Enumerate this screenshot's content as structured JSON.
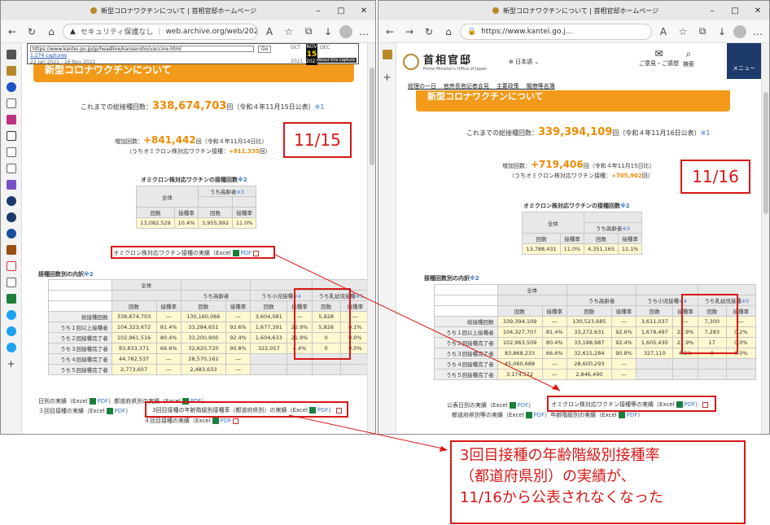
{
  "left": {
    "tab_title": "新型コロナワクチンについて | 首相官邸ホームページ",
    "security_warning": "セキュリティ保護なし",
    "url": "web.archive.org/web/202...",
    "wayback": {
      "url_field": "https://www.kantei.go.jp/jp/headline/kansensho/vaccine.html",
      "go_label": "Go",
      "captures": "1,274 captures",
      "date_range": "22 Jan 2021 - 16 Nov 2022",
      "month_prev": "OCT",
      "month_now": "NOV",
      "day_now": "15",
      "month_next": "DEC",
      "year_prev": "2021",
      "year_now": "2022",
      "year_next": "2023",
      "about": "About this capture"
    },
    "page_title": "新型コロナワクチンについて",
    "total_label": "これまでの総接種回数：",
    "total_value": "338,674,703",
    "total_suffix": "回（令和４年11月15日公表）",
    "note1": "※1",
    "inc_label": "増加回数：",
    "inc_value": "+841,442",
    "inc_suffix": "回（令和４年11月14日比）",
    "omi_inc_label": "（うちオミクロン株対応ワクチン接種：",
    "omi_inc_value": "+811,335",
    "omi_inc_suffix": "回）",
    "date_box": "11/15",
    "omi_table_title": "オミクロン株対応ワクチンの接種回数",
    "note2": "※2",
    "omi_hdr_all": "全体",
    "omi_hdr_old": "うち高齢者",
    "note3": "※3",
    "col_count": "回数",
    "col_rate": "接種率",
    "omi_row": [
      "13,082,529",
      "10.4%",
      "3,955,992",
      "11.0%"
    ],
    "omi_link_text": "オミクロン株対応ワクチン接種の実績（Excel",
    "pdf": "PDF",
    "close_paren": "）",
    "breakdown_title": "接種回数別の内訳",
    "bd_hdr_old": "うち高齢者",
    "bd_hdr_child": "うち小児接種",
    "note4": "※4",
    "bd_hdr_infant": "うち乳幼児接種",
    "note5": "※5",
    "dash": "―",
    "rows": [
      {
        "label": "総接種回数",
        "c": [
          "338,674,703",
          "―",
          "130,160,066",
          "―",
          "3,604,081",
          "―",
          "5,828",
          "―"
        ]
      },
      {
        "label": "うち１回以上接種者",
        "c": [
          "104,323,672",
          "81.4%",
          "33,284,651",
          "92.6%",
          "1,677,391",
          "22.9%",
          "5,828",
          "0.1%"
        ]
      },
      {
        "label": "うち２回接種完了者",
        "c": [
          "102,961,516",
          "80.4%",
          "33,200,900",
          "92.4%",
          "1,604,633",
          "21.9%",
          "0",
          "0.0%"
        ]
      },
      {
        "label": "うち３回接種完了者",
        "c": [
          "83,833,371",
          "66.6%",
          "32,620,720",
          "90.8%",
          "322,057",
          "4.4%",
          "0",
          "0.0%"
        ]
      },
      {
        "label": "うち４回接種完了者",
        "c": [
          "44,782,537",
          "―",
          "28,570,162",
          "―"
        ]
      },
      {
        "label": "うち５回接種完了者",
        "c": [
          "2,773,607",
          "―",
          "2,483,633",
          "―"
        ]
      }
    ],
    "bottom1": "日別の実績（Excel",
    "bottom1b": "）都道府県別の実績（Excel",
    "bottom1c": "）",
    "bottom2": "３回目接種の実績（Excel",
    "bottom2b": "3回目接種の年齢階級別接種率（都道府県別）の実績（Excel",
    "bottom3": "４回目接種の実績（Excel",
    "bottom1d": "年齢階級別の実績"
  },
  "right": {
    "tab_title": "新型コロナワクチンについて | 首相官邸ホームページ",
    "url": "https://www.kantei.go.j...",
    "logo_jp": "首相官邸",
    "logo_en": "Prime Minister's Office of Japan",
    "lang": "日本語",
    "opinion": "ご意見・ご感想",
    "search": "検索",
    "menu": "メニュー",
    "nav": [
      "総理の一日",
      "官房長官記者会見",
      "主要政策",
      "閣僚等名簿"
    ],
    "page_title": "新型コロナワクチンについて",
    "total_label": "これまでの総接種回数：",
    "total_value": "339,394,109",
    "total_suffix": "回（令和４年11月16日公表）",
    "note1": "※1",
    "inc_label": "増加回数：",
    "inc_value": "+719,406",
    "inc_suffix": "回（令和４年11月15日比）",
    "omi_inc_label": "（うちオミクロン株対応ワクチン接種：",
    "omi_inc_value": "+705,902",
    "omi_inc_suffix": "回）",
    "date_box": "11/16",
    "omi_table_title": "オミクロン株対応ワクチンの接種回数",
    "omi_row": [
      "13,788,431",
      "11.0%",
      "4,351,165",
      "12.1%"
    ],
    "breakdown_title": "接種回数別の内訳",
    "rows": [
      {
        "label": "総接種回数",
        "c": [
          "339,394,109",
          "―",
          "130,523,685",
          "―",
          "3,611,037",
          "―",
          "7,300",
          "―"
        ]
      },
      {
        "label": "うち１回以上接種者",
        "c": [
          "104,327,707",
          "81.4%",
          "33,272,631",
          "92.6%",
          "1,678,497",
          "22.9%",
          "7,283",
          "0.2%"
        ]
      },
      {
        "label": "うち２回接種完了者",
        "c": [
          "102,963,509",
          "80.4%",
          "33,188,987",
          "92.4%",
          "1,605,430",
          "21.9%",
          "17",
          "0.0%"
        ]
      },
      {
        "label": "うち３回接種完了者",
        "c": [
          "83,868,233",
          "66.6%",
          "32,615,284",
          "90.8%",
          "327,110",
          "4.5%",
          "0",
          "0.0%"
        ]
      },
      {
        "label": "うち４回接種完了者",
        "c": [
          "45,060,688",
          "―",
          "28,600,293",
          "―"
        ]
      },
      {
        "label": "うち５回接種完了者",
        "c": [
          "3,174,572",
          "―",
          "2,846,490",
          "―"
        ]
      }
    ],
    "bottom1": "公表日別の実績（Excel",
    "omi_link_text": "オミクロン株対応ワクチン接種等の実績（Excel",
    "bottom2": "都道府県別等の実績（Excel",
    "bottom2b": "年齢階級別の実績（Excel"
  },
  "annotation": {
    "line1": "3回目接種の年齢階級別接種率",
    "line2": "（都道府県別）の実績が、",
    "line3": "11/16から公表されなくなった"
  },
  "colors": {
    "accent": "#f39a1a",
    "highlight": "#d81818",
    "link": "#3a73c8"
  }
}
